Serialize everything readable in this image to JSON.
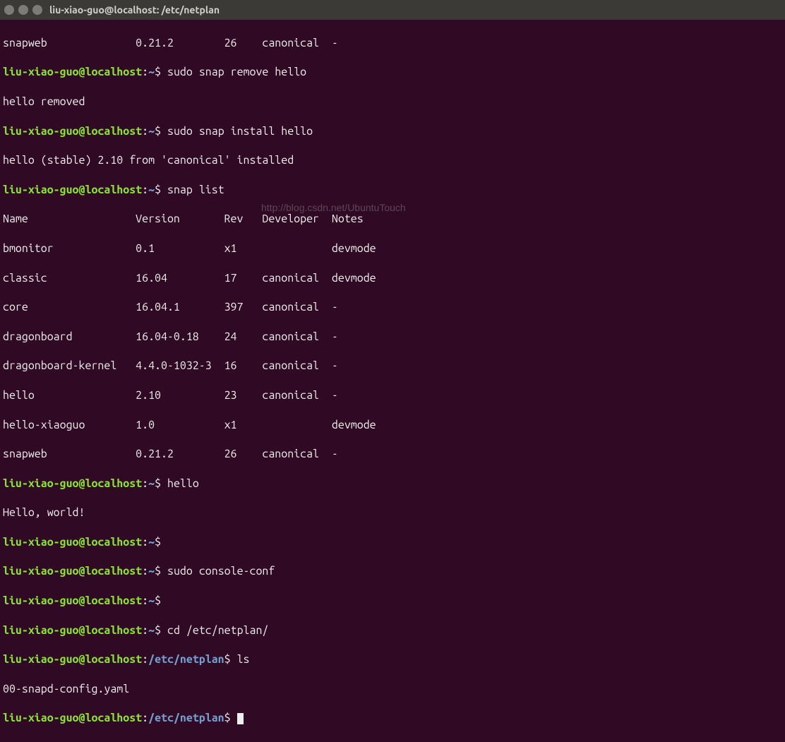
{
  "window": {
    "title": "liu-xiao-guo@localhost: /etc/netplan"
  },
  "prompt": {
    "user": "liu-xiao-guo",
    "at": "@",
    "host": "localhost",
    "colon": ":",
    "path_home": "~",
    "path_netplan": "/etc/netplan",
    "dollar": "$"
  },
  "pre_lines": {
    "snapweb": "snapweb              0.21.2        26    canonical  -"
  },
  "commands": {
    "remove_hello": "sudo snap remove hello",
    "remove_hello_out": "hello removed",
    "install_hello": "sudo snap install hello",
    "install_hello_out": "hello (stable) 2.10 from 'canonical' installed",
    "snap_list": "snap list",
    "hello": "hello",
    "hello_out": "Hello, world!",
    "console_conf": "sudo console-conf",
    "cd_netplan": "cd /etc/netplan/",
    "ls": "ls",
    "ls_out": "00-snapd-config.yaml"
  },
  "snap_list_header": "Name                 Version       Rev   Developer  Notes",
  "snap_list_rows": [
    "bmonitor             0.1           x1               devmode",
    "classic              16.04         17    canonical  devmode",
    "core                 16.04.1       397   canonical  -",
    "dragonboard          16.04-0.18    24    canonical  -",
    "dragonboard-kernel   4.4.0-1032-3  16    canonical  -",
    "hello                2.10          23    canonical  -",
    "hello-xiaoguo        1.0           x1               devmode",
    "snapweb              0.21.2        26    canonical  -"
  ],
  "watermark": "http://blog.csdn.net/UbuntuTouch"
}
